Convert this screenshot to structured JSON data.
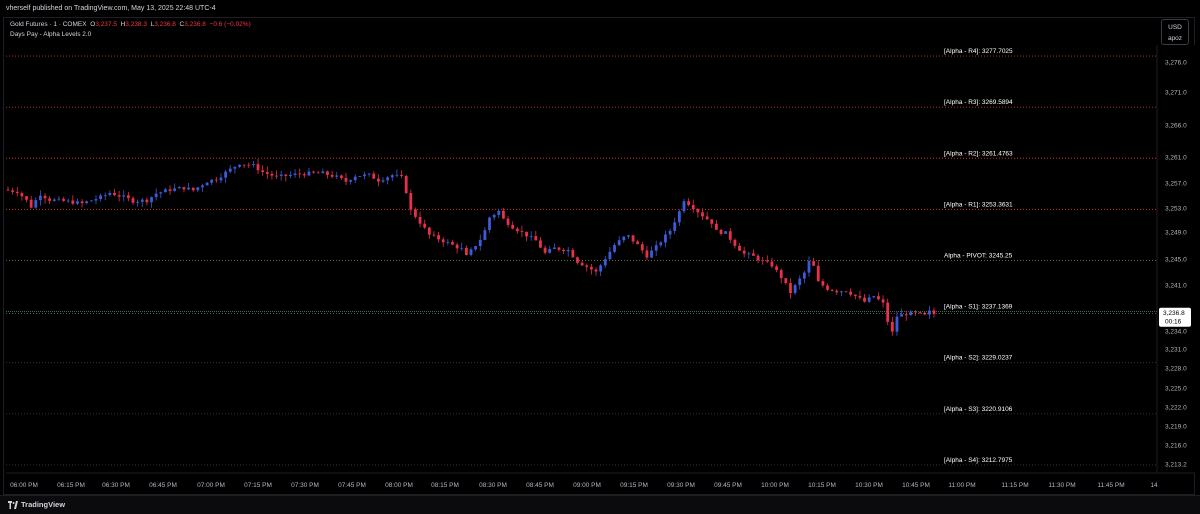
{
  "topbar": {
    "publisher": "vherself published on TradingView.com, May 13, 2025 22:48 UTC-4"
  },
  "legend": {
    "symbol": "Gold Futures · 1 · COMEX",
    "o_label": "O",
    "o": "3,237.5",
    "h_label": "H",
    "h": "3,238.3",
    "l_label": "L",
    "l": "3,236.8",
    "c_label": "C",
    "c": "3,236.8",
    "change": "−0.6 (−0.02%)",
    "indicator": "Days Pay - Alpha Levels 2.0"
  },
  "currency": {
    "unit": "USD",
    "sub": "apoz"
  },
  "footer": {
    "brand": "TradingView"
  },
  "colors": {
    "up": "#3b5bdb",
    "down": "#e8304a",
    "level": "#c0392b",
    "pivot": "#7a7a3a",
    "s1": "#2e8b57"
  },
  "chart_data": {
    "type": "candlestick",
    "title": "",
    "y_ticks": [
      "3,276.0",
      "3,271.0",
      "3,266.0",
      "3,261.0",
      "3,257.0",
      "3,253.0",
      "3,249.0",
      "3,245.0",
      "3,241.0",
      "3,234.0",
      "3,231.0",
      "3,228.0",
      "3,225.0",
      "3,222.0",
      "3,219.0",
      "3,216.0",
      "3,213.2"
    ],
    "x_ticks": [
      "06:00 PM",
      "06:15 PM",
      "06:30 PM",
      "06:45 PM",
      "07:00 PM",
      "07:15 PM",
      "07:30 PM",
      "07:45 PM",
      "08:00 PM",
      "08:15 PM",
      "08:30 PM",
      "08:45 PM",
      "09:00 PM",
      "09:15 PM",
      "09:30 PM",
      "09:45 PM",
      "10:00 PM",
      "10:15 PM",
      "10:30 PM",
      "10:45 PM",
      "11:00 PM",
      "11:15 PM",
      "11:30 PM",
      "11:45 PM",
      "14"
    ],
    "levels": [
      {
        "label": "[Alpha - R4]: 3277.7025",
        "value": 3277.7025,
        "kind": "r"
      },
      {
        "label": "[Alpha - R3]: 3269.5894",
        "value": 3269.5894,
        "kind": "r"
      },
      {
        "label": "[Alpha - R2]: 3261.4763",
        "value": 3261.4763,
        "kind": "r"
      },
      {
        "label": "[Alpha - R1]: 3253.3631",
        "value": 3253.3631,
        "kind": "r"
      },
      {
        "label": "Alpha - PIVOT: 3245.25",
        "value": 3245.25,
        "kind": "p"
      },
      {
        "label": "[Alpha - S1]: 3237.1369",
        "value": 3237.1369,
        "kind": "s1"
      },
      {
        "label": "[Alpha - S2]: 3229.0237",
        "value": 3229.0237,
        "kind": "s"
      },
      {
        "label": "[Alpha - S3]: 3220.9106",
        "value": 3220.9106,
        "kind": "s"
      },
      {
        "label": "[Alpha - S4]: 3212.7975",
        "value": 3212.7975,
        "kind": "s"
      }
    ],
    "last_price": "3,236.8",
    "countdown": "00:16",
    "path": [
      [
        0,
        3256.5
      ],
      [
        3,
        3256.2
      ],
      [
        5,
        3254.8
      ],
      [
        6,
        3253.8
      ],
      [
        8,
        3255.8
      ],
      [
        10,
        3254.9
      ],
      [
        14,
        3254.6
      ],
      [
        17,
        3254.3
      ],
      [
        19,
        3254.8
      ],
      [
        21,
        3255.3
      ],
      [
        23,
        3256.0
      ],
      [
        26,
        3255.3
      ],
      [
        28,
        3254.7
      ],
      [
        31,
        3254.8
      ],
      [
        33,
        3255.9
      ],
      [
        36,
        3256.5
      ],
      [
        39,
        3256.8
      ],
      [
        41,
        3256.4
      ],
      [
        44,
        3257.8
      ],
      [
        46,
        3258.2
      ],
      [
        49,
        3259.7
      ],
      [
        51,
        3260.7
      ],
      [
        54,
        3260.3
      ],
      [
        56,
        3259.3
      ],
      [
        59,
        3258.5
      ],
      [
        62,
        3258.8
      ],
      [
        64,
        3259.0
      ],
      [
        67,
        3259.1
      ],
      [
        69,
        3259.1
      ],
      [
        72,
        3258.5
      ],
      [
        74,
        3257.8
      ],
      [
        76,
        3258.7
      ],
      [
        79,
        3258.8
      ],
      [
        81,
        3258.0
      ],
      [
        84,
        3258.8
      ],
      [
        86,
        3258.4
      ],
      [
        87,
        3256.2
      ],
      [
        88,
        3253.2
      ],
      [
        89,
        3252.3
      ],
      [
        90,
        3251.3
      ],
      [
        92,
        3249.3
      ],
      [
        94,
        3248.7
      ],
      [
        97,
        3247.7
      ],
      [
        99,
        3247.1
      ],
      [
        100,
        3245.9
      ],
      [
        101,
        3246.8
      ],
      [
        103,
        3248.6
      ],
      [
        104,
        3250.0
      ],
      [
        105,
        3252.1
      ],
      [
        107,
        3253.1
      ],
      [
        108,
        3251.8
      ],
      [
        110,
        3250.6
      ],
      [
        112,
        3249.7
      ],
      [
        115,
        3248.4
      ],
      [
        117,
        3246.4
      ],
      [
        119,
        3247.2
      ],
      [
        122,
        3246.9
      ],
      [
        124,
        3245.1
      ],
      [
        126,
        3244.3
      ],
      [
        128,
        3243.4
      ],
      [
        130,
        3245.6
      ],
      [
        132,
        3247.7
      ],
      [
        134,
        3248.9
      ],
      [
        135,
        3249.1
      ],
      [
        137,
        3247.7
      ],
      [
        139,
        3246.0
      ],
      [
        141,
        3247.4
      ],
      [
        144,
        3250.0
      ],
      [
        146,
        3253.0
      ],
      [
        147,
        3254.9
      ],
      [
        149,
        3253.7
      ],
      [
        151,
        3252.4
      ],
      [
        153,
        3251.3
      ],
      [
        154,
        3249.9
      ],
      [
        156,
        3249.6
      ],
      [
        158,
        3247.8
      ],
      [
        160,
        3246.3
      ],
      [
        162,
        3245.9
      ],
      [
        164,
        3245.1
      ],
      [
        166,
        3244.5
      ],
      [
        168,
        3242.6
      ],
      [
        170,
        3240.2
      ],
      [
        171,
        3241.2
      ],
      [
        173,
        3243.3
      ],
      [
        174,
        3245.0
      ],
      [
        175,
        3244.3
      ],
      [
        176,
        3241.8
      ],
      [
        178,
        3240.8
      ],
      [
        180,
        3240.4
      ],
      [
        182,
        3240.5
      ],
      [
        184,
        3239.6
      ],
      [
        186,
        3238.7
      ],
      [
        188,
        3239.6
      ],
      [
        190,
        3238.4
      ],
      [
        191,
        3235.6
      ],
      [
        192,
        3233.8
      ],
      [
        193,
        3236.4
      ],
      [
        195,
        3236.8
      ],
      [
        197,
        3236.9
      ],
      [
        199,
        3236.5
      ],
      [
        200,
        3237.1
      ],
      [
        201,
        3236.8
      ]
    ]
  }
}
